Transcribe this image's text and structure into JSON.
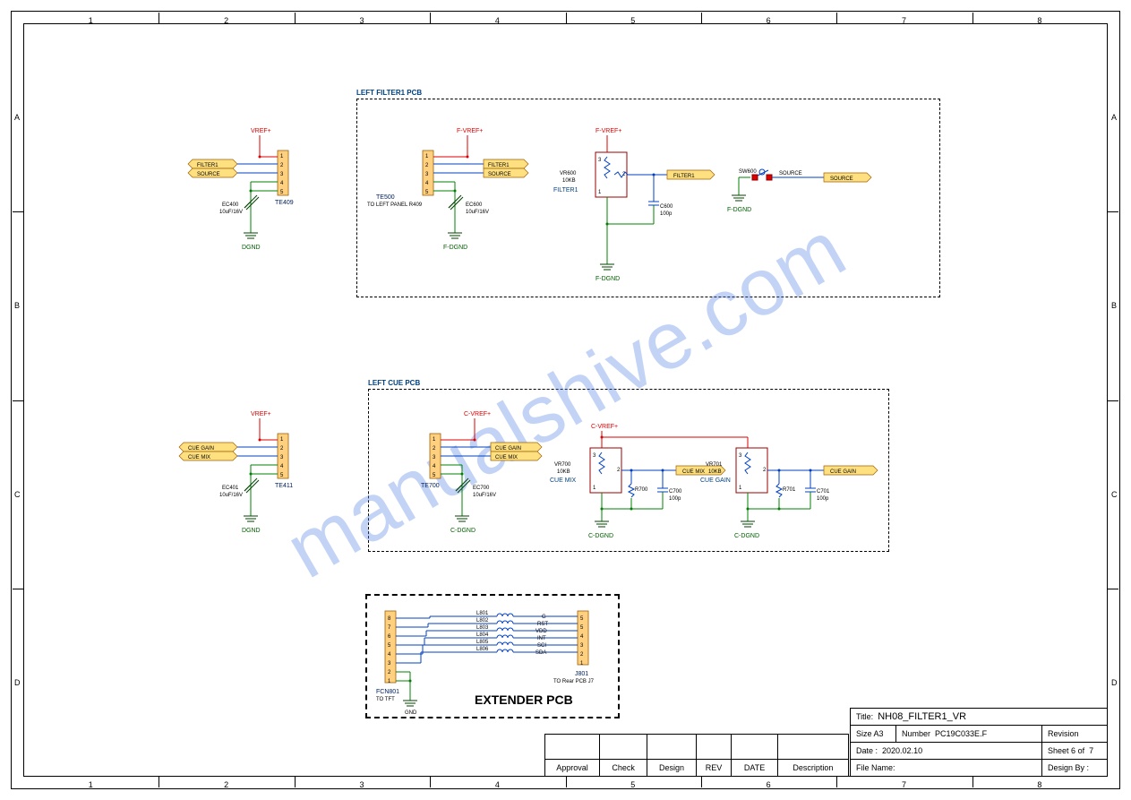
{
  "grid": {
    "cols": [
      "1",
      "2",
      "3",
      "4",
      "5",
      "6",
      "7",
      "8"
    ],
    "rows": [
      "A",
      "B",
      "C",
      "D"
    ]
  },
  "watermark": "manualshive.com",
  "sections": {
    "filter_pcb_label": "LEFT FILTER1 PCB",
    "cue_pcb_label": "LEFT CUE PCB",
    "extender_label": "EXTENDER PCB"
  },
  "block_left_top": {
    "vref": "VREF+",
    "port1": "FILTER1",
    "port2": "SOURCE",
    "conn": "TE409",
    "cap_ref": "EC400",
    "cap_val": "10uF/16V",
    "gnd": "DGND",
    "pins": [
      "1",
      "2",
      "3",
      "4",
      "5"
    ]
  },
  "filter_pcb": {
    "vref": "F-VREF+",
    "conn": "TE500",
    "conn_note": "TO LEFT PANEL R409",
    "port1": "FILTER1",
    "port2": "SOURCE",
    "cap_ref": "EC600",
    "cap_val": "10uF/16V",
    "gnd": "F-DGND",
    "pins": [
      "1",
      "2",
      "3",
      "4",
      "5"
    ],
    "pot_block": {
      "vref": "F-VREF+",
      "pot_ref": "VR600",
      "pot_val": "10KB",
      "label": "FILTER1",
      "c_ref": "C600",
      "c_val": "100p",
      "out": "FILTER1",
      "gnd": "F-DGND",
      "pins": [
        "1",
        "2",
        "3"
      ]
    },
    "switch_block": {
      "sw_ref": "SW600",
      "label": "SOURCE",
      "out": "SOURCE",
      "gnd": "F-DGND"
    }
  },
  "block_left_mid": {
    "vref": "VREF+",
    "port1": "CUE GAIN",
    "port2": "CUE MIX",
    "conn": "TE411",
    "cap_ref": "EC401",
    "cap_val": "10uF/16V",
    "gnd": "DGND",
    "pins": [
      "1",
      "2",
      "3",
      "4",
      "5"
    ]
  },
  "cue_pcb": {
    "vref": "C-VREF+",
    "conn": "TE700",
    "port1": "CUE GAIN",
    "port2": "CUE MIX",
    "cap_ref": "EC700",
    "cap_val": "10uF/16V",
    "gnd": "C-DGND",
    "pins": [
      "1",
      "2",
      "3",
      "4",
      "5"
    ],
    "pot1": {
      "vref": "C-VREF+",
      "pot_ref": "VR700",
      "pot_val": "10KB",
      "label": "CUE MIX",
      "r_ref": "R700",
      "c_ref": "C700",
      "c_val": "100p",
      "out": "CUE MIX",
      "gnd": "C-DGND",
      "pins": [
        "1",
        "2",
        "3"
      ]
    },
    "pot2": {
      "pot_ref": "VR701",
      "pot_val": "10KB",
      "label": "CUE GAIN",
      "r_ref": "R701",
      "c_ref": "C701",
      "c_val": "100p",
      "out": "CUE GAIN",
      "gnd": "C-DGND",
      "pins": [
        "1",
        "2",
        "3"
      ]
    }
  },
  "extender": {
    "conn_left": "FCN801",
    "conn_left_note": "TO TFT",
    "conn_right": "J801",
    "conn_right_note": "TO Rear PCB J7",
    "left_pins": [
      "8",
      "7",
      "6",
      "5",
      "4",
      "3",
      "2",
      "1"
    ],
    "right_pins": [
      "5",
      "5",
      "4",
      "3",
      "2",
      "1"
    ],
    "beads": [
      "L801",
      "L802",
      "L803",
      "L804",
      "L805",
      "L806"
    ],
    "nets": [
      "G",
      "RST",
      "VDD",
      "INT",
      "SCI",
      "SDA"
    ],
    "gnd": "GND"
  },
  "title_block": {
    "title_label": "Title:",
    "title": "NH08_FILTER1_VR",
    "size_label": "Size",
    "size": "A3",
    "number_label": "Number",
    "number": "PC19C033E.F",
    "revision_label": "Revision",
    "date_label": "Date :",
    "date": "2020.02.10",
    "sheet_label": "Sheet",
    "sheet_of": "of",
    "sheet_num": "6",
    "sheet_total": "7",
    "file_label": "File Name:",
    "design_label": "Design By :"
  },
  "rev_block": {
    "headers": [
      "Approval",
      "Check",
      "Design",
      "REV",
      "DATE",
      "Description"
    ]
  }
}
